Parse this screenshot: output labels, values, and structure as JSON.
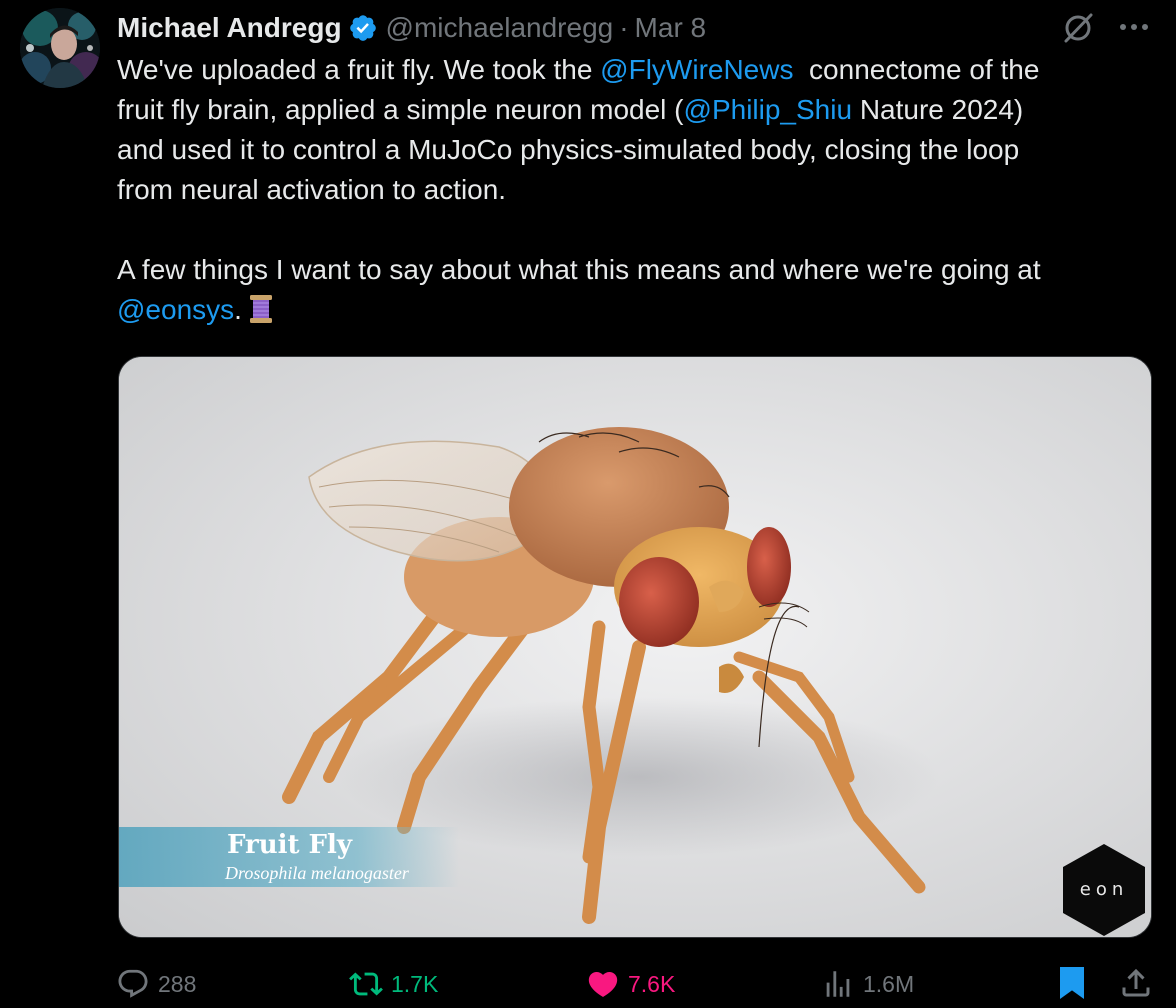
{
  "tweet": {
    "author_name": "Michael Andregg",
    "handle": "@michaelandregg",
    "separator": "·",
    "date": "Mar 8",
    "text": {
      "l1_pre": "We've uploaded a fruit fly. We took the ",
      "l1_mention": "@FlyWireNews",
      "l1_post": "  connectome of the",
      "l2_pre": "fruit fly brain, applied a simple neuron model (",
      "l2_mention": "@Philip_Shiu",
      "l2_post": " Nature 2024)",
      "l3": "and used it to control a MuJoCo physics-simulated body, closing the loop",
      "l4": "from neural activation to action.",
      "l5": "A few things I want to say about what this means and where we're going at",
      "l6_mention": "@eonsys",
      "l6_post": "."
    },
    "media": {
      "caption_title": "Fruit Fly",
      "caption_subtitle": "Drosophila melanogaster",
      "logo_text": "eon"
    },
    "stats": {
      "replies": "288",
      "reposts": "1.7K",
      "likes": "7.6K",
      "views": "1.6M"
    },
    "icons": {
      "verified": "verified-badge-icon",
      "grok": "grok-icon",
      "more": "more-icon",
      "thread": "spool-emoji-icon",
      "reply": "reply-icon",
      "repost": "repost-icon",
      "like": "heart-icon",
      "views": "views-icon",
      "bookmark": "bookmark-icon",
      "share": "share-icon"
    },
    "colors": {
      "mention": "#1d9bf0",
      "repost_active": "#00ba7c",
      "like_active": "#f91880",
      "muted": "#71767b"
    }
  }
}
